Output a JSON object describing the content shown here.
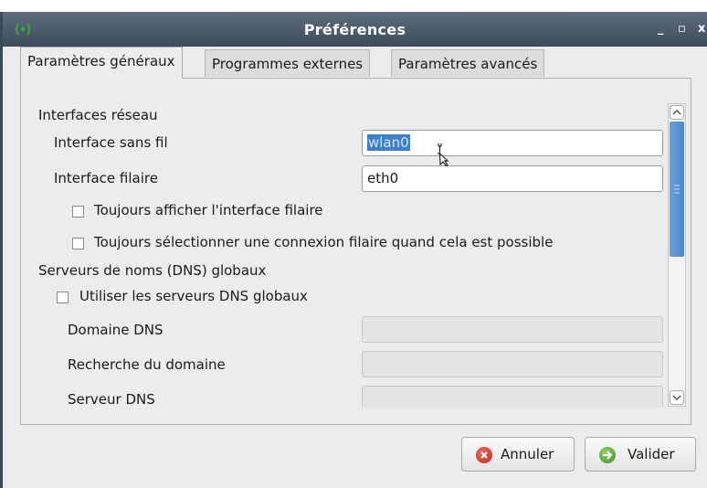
{
  "window": {
    "title": "Préférences",
    "controls": [
      "_",
      "▫",
      "x"
    ]
  },
  "tabs": [
    {
      "label": "Paramètres généraux",
      "active": true
    },
    {
      "label": "Programmes externes",
      "active": false
    },
    {
      "label": "Paramètres avancés",
      "active": false
    }
  ],
  "network": {
    "section_label": "Interfaces réseau",
    "wireless_label": "Interface sans fil",
    "wireless_value": "wlan0",
    "wired_label": "Interface filaire",
    "wired_value": "eth0",
    "always_show_wired_label": "Toujours afficher l'interface filaire",
    "always_select_wired_label": "Toujours sélectionner une connexion filaire quand cela est possible"
  },
  "dns": {
    "section_label": "Serveurs de noms (DNS) globaux",
    "use_global_label": "Utiliser les serveurs DNS globaux",
    "domain_label": "Domaine DNS",
    "search_label": "Recherche du domaine",
    "server_label": "Serveur DNS"
  },
  "buttons": {
    "cancel_label": "Annuler",
    "ok_label": "Valider"
  },
  "colors": {
    "titlebar": "#4d5c6b",
    "selection": "#3d80c9",
    "scroll_thumb": "#4a88cc",
    "cancel_icon": "#d9302c",
    "ok_icon": "#4fa83a"
  }
}
